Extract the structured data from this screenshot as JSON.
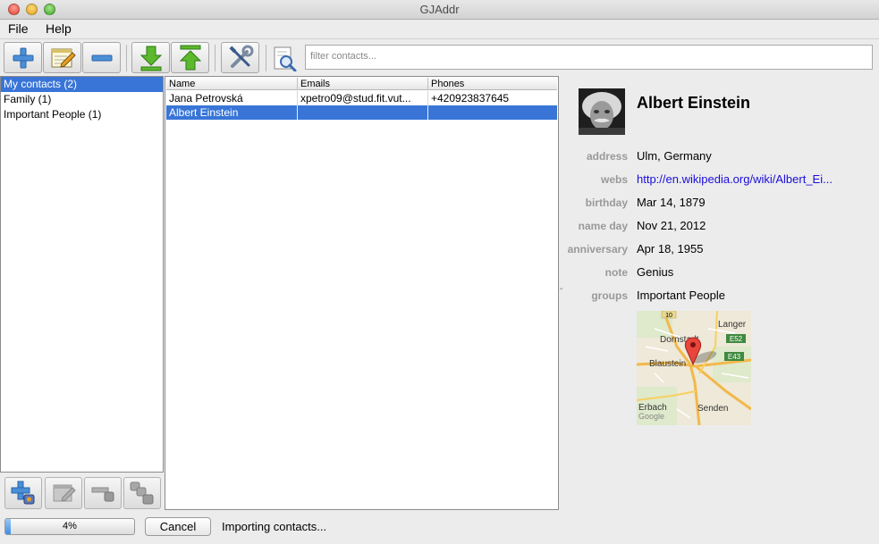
{
  "window": {
    "title": "GJAddr"
  },
  "menu": {
    "file": "File",
    "help": "Help"
  },
  "toolbar": {
    "buttons": [
      "add-contact-icon",
      "edit-contact-icon",
      "remove-contact-icon",
      "import-icon",
      "export-icon",
      "settings-icon"
    ],
    "filter_placeholder": "filter contacts..."
  },
  "groups": [
    {
      "label": "My contacts (2)",
      "selected": true
    },
    {
      "label": "Family (1)",
      "selected": false
    },
    {
      "label": "Important People (1)",
      "selected": false
    }
  ],
  "group_tools": [
    "add-group-icon",
    "edit-group-icon",
    "remove-group-icon",
    "merge-groups-icon"
  ],
  "contacts_table": {
    "columns": [
      "Name",
      "Emails",
      "Phones"
    ],
    "rows": [
      {
        "name": "Jana Petrovská",
        "emails": "xpetro09@stud.fit.vut...",
        "phones": "+420923837645",
        "selected": false
      },
      {
        "name": "Albert Einstein",
        "emails": "",
        "phones": "",
        "selected": true
      }
    ]
  },
  "detail": {
    "name": "Albert Einstein",
    "fields": [
      {
        "label": "address",
        "value": "Ulm, Germany"
      },
      {
        "label": "webs",
        "value": "http://en.wikipedia.org/wiki/Albert_Ei...",
        "link": true
      },
      {
        "label": "birthday",
        "value": "Mar 14, 1879"
      },
      {
        "label": "name day",
        "value": "Nov 21, 2012"
      },
      {
        "label": "anniversary",
        "value": "Apr 18, 1955"
      },
      {
        "label": "note",
        "value": "Genius"
      },
      {
        "label": "groups",
        "value": "Important People"
      }
    ],
    "map_labels": {
      "road_10": "10",
      "langer": "Langer",
      "dornstadt": "Dornstadt",
      "e52": "E52",
      "e43": "E43",
      "blaustein": "Blaustein",
      "erbach": "Erbach",
      "senden": "Senden",
      "google": "Google"
    }
  },
  "status": {
    "progress": 0.04,
    "progress_text": "4%",
    "cancel_label": "Cancel",
    "message": "Importing contacts..."
  },
  "colors": {
    "selection": "#3875d7",
    "link": "#1a0ddb",
    "label_gray": "#999999"
  }
}
